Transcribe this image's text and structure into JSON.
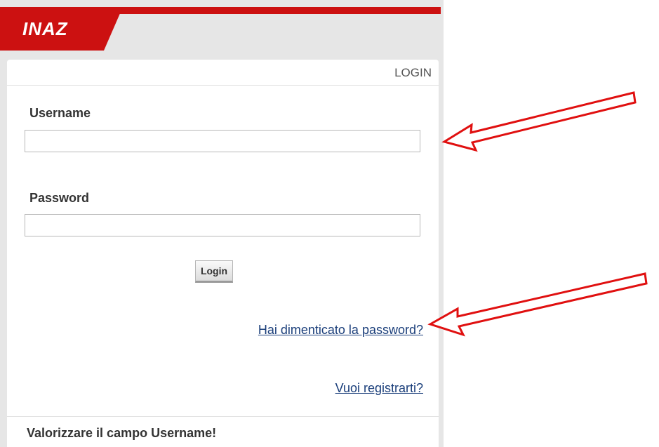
{
  "brand": {
    "logo_text": "INAZ",
    "accent_color": "#cc1111"
  },
  "panel": {
    "title": "LOGIN"
  },
  "form": {
    "username_label": "Username",
    "username_value": "",
    "password_label": "Password",
    "password_value": "",
    "submit_label": "Login"
  },
  "links": {
    "forgot_password": "Hai dimenticato la password?",
    "register": "Vuoi registrarti?"
  },
  "status": {
    "message": "Valorizzare il campo Username!"
  },
  "annotations": {
    "arrow_color": "#e01010"
  }
}
